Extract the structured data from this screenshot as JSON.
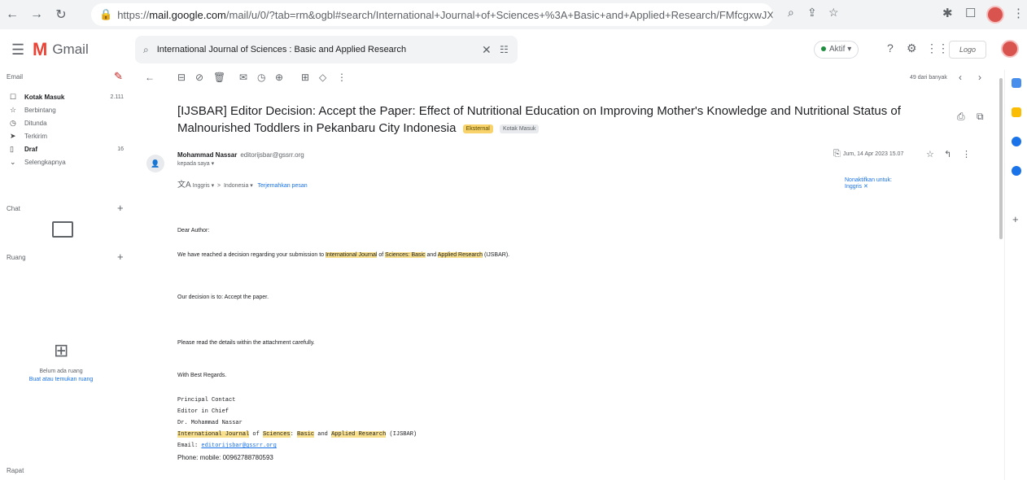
{
  "browser": {
    "url_scheme": "https://",
    "url_host": "mail.google.com",
    "url_path": "/mail/u/0/?tab=rm&ogbl#search/International+Journal+of+Sciences+%3A+Basic+and+Applied+Research/FMfcgxwJXL..."
  },
  "header": {
    "app_name": "Gmail",
    "search_value": "International Journal of Sciences : Basic and Applied Research",
    "status": "Aktif"
  },
  "sidebar": {
    "email_title": "Email",
    "items": [
      {
        "label": "Kotak Masuk",
        "count": "2.111"
      },
      {
        "label": "Berbintang",
        "count": ""
      },
      {
        "label": "Ditunda",
        "count": ""
      },
      {
        "label": "Terkirim",
        "count": ""
      },
      {
        "label": "Draf",
        "count": "16"
      },
      {
        "label": "Selengkapnya",
        "count": ""
      }
    ],
    "chat_title": "Chat",
    "rooms_title": "Ruang",
    "rooms_empty": "Belum ada ruang",
    "rooms_link": "Buat atau temukan ruang",
    "meet_title": "Rapat"
  },
  "toolbar": {
    "page_info": "49 dari banyak"
  },
  "email": {
    "subject": "[IJSBAR] Editor Decision: Accept the Paper: Effect of Nutritional Education on Improving Mother's Knowledge and Nutritional Status of Malnourished Toddlers in Pekanbaru City Indonesia",
    "label1": "Eksternal",
    "label2": "Kotak Masuk",
    "sender_name": "Mohammad Nassar",
    "sender_email": "editorijsbar@gssrr.org",
    "to": "kepada saya",
    "date": "Jum, 14 Apr 2023 15.07",
    "translate_from": "Inggris",
    "translate_to": "Indonesia",
    "translate_link": "Terjemahkan pesan",
    "translate_off": "Nonaktifkan untuk: Inggris",
    "body": {
      "greeting": "Dear Author:",
      "l1_pre": "We have reached a decision regarding your submission to ",
      "j1": "International Journal",
      "w_of": " of ",
      "j2": "Sciences: Basic",
      "w_and": " and ",
      "j3": "Applied Research",
      "l1_post": " (IJSBAR).",
      "l2": "Our decision is to: Accept the paper.",
      "l3": "Please read the details within the attachment carefully.",
      "l4": "With Best Regards.",
      "s1": "Principal Contact",
      "s2": "Editor in Chief",
      "s3": "Dr. Mohammad Nassar",
      "s4_a": "International Journal",
      "s4_b": " of ",
      "s4_c": "Sciences",
      "s4_d": ": ",
      "s4_e": "Basic",
      "s4_f": " and ",
      "s4_g": "Applied Research",
      "s4_h": " (IJSBAR)",
      "s5_label": "Email: ",
      "s5_link": "editorijsbar@gssrr.org",
      "s6": "Phone: mobile: 00962788780593"
    }
  },
  "colors": {
    "accent": "#1a73e8",
    "highlight": "#f8e08e",
    "chip_external": "#f8d36b",
    "gmail_red": "#ea4335"
  }
}
